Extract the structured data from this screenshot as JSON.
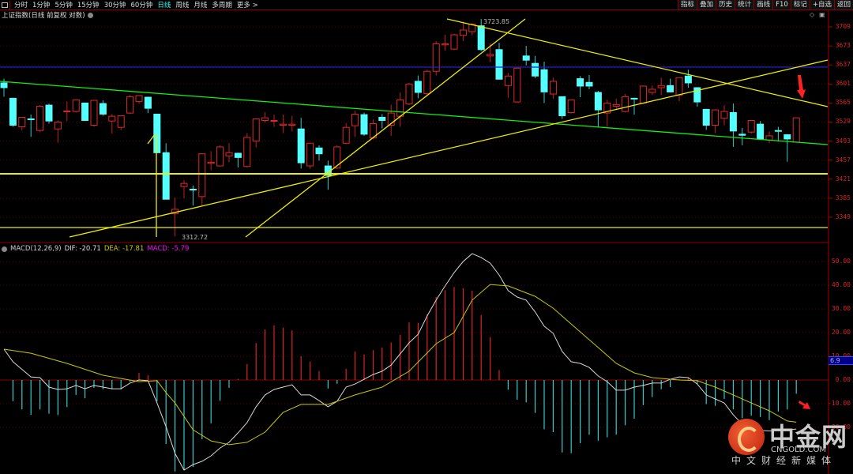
{
  "toolbar": {
    "periods": [
      "分时",
      "1分钟",
      "5分钟",
      "15分钟",
      "30分钟",
      "60分钟",
      "日线",
      "周线",
      "月线",
      "多周期",
      "更多 >"
    ],
    "active_period": "日线",
    "right_buttons": [
      "指标",
      "叠加",
      "历史",
      "统计",
      "画线",
      "F10",
      "标记",
      "+自选",
      "返回"
    ]
  },
  "chart_title": "上证指数(日线 前复权 对数)",
  "macd_header": {
    "name": "MACD(12,26,9)",
    "dif": "DIF: -20.71",
    "dea": "DEA: -17.81",
    "macd": "MACD: -5.79"
  },
  "annotations": {
    "high": "3723.85",
    "low": "3312.72"
  },
  "macd_badge": "6.9",
  "watermark": {
    "cn": "中金网",
    "en": "CNGOLD.COM",
    "sub": "中文财经新媒体"
  },
  "colors": {
    "up": "#ff3232",
    "down": "#54ffff",
    "dif": "#d8d8d8",
    "dea": "#c8c800",
    "macd_label": "#ff00ff",
    "grid": "#5a0000"
  },
  "chart_data": [
    {
      "type": "candlestick",
      "title": "上证指数 日线",
      "price_axis_ticks": [
        "3709",
        "3673",
        "3637",
        "3601",
        "3565",
        "3529",
        "3493",
        "3457",
        "3421",
        "3385",
        "3349"
      ],
      "ylim": [
        3295,
        3760
      ],
      "candles_ohlc": [
        [
          3603,
          3594,
          3611,
          3577
        ],
        [
          3574,
          3523,
          3574,
          3520
        ],
        [
          3520,
          3538,
          3538,
          3513
        ],
        [
          3535,
          3534,
          3543,
          3501
        ],
        [
          3513,
          3559,
          3561,
          3510
        ],
        [
          3561,
          3531,
          3564,
          3526
        ],
        [
          3516,
          3529,
          3532,
          3490
        ],
        [
          3549,
          3550,
          3568,
          3531
        ],
        [
          3549,
          3571,
          3571,
          3547
        ],
        [
          3565,
          3532,
          3565,
          3531
        ],
        [
          3523,
          3570,
          3570,
          3520
        ],
        [
          3564,
          3544,
          3570,
          3541
        ],
        [
          3531,
          3540,
          3544,
          3507
        ],
        [
          3519,
          3541,
          3541,
          3514
        ],
        [
          3546,
          3577,
          3580,
          3544
        ],
        [
          3568,
          3579,
          3580,
          3564
        ],
        [
          3576,
          3555,
          3577,
          3546
        ],
        [
          3544,
          3471,
          3544,
          3470
        ],
        [
          3471,
          3383,
          3489,
          3383
        ],
        [
          3356,
          3364,
          3386,
          3312.72
        ],
        [
          3407,
          3413,
          3419,
          3385
        ],
        [
          3402,
          3401,
          3409,
          3371
        ],
        [
          3388,
          3469,
          3470,
          3371
        ],
        [
          3451,
          3453,
          3474,
          3438
        ],
        [
          3446,
          3482,
          3485,
          3445
        ],
        [
          3465,
          3471,
          3489,
          3453
        ],
        [
          3470,
          3462,
          3471,
          3443
        ],
        [
          3445,
          3500,
          3508,
          3443
        ],
        [
          3493,
          3535,
          3536,
          3481
        ],
        [
          3532,
          3537,
          3548,
          3528
        ],
        [
          3531,
          3532,
          3543,
          3520
        ],
        [
          3523,
          3525,
          3543,
          3508
        ],
        [
          3523,
          3525,
          3541,
          3511
        ],
        [
          3516,
          3452,
          3537,
          3441
        ],
        [
          3446,
          3489,
          3490,
          3441
        ],
        [
          3480,
          3469,
          3485,
          3456
        ],
        [
          3446,
          3428,
          3456,
          3401
        ],
        [
          3442,
          3482,
          3485,
          3440
        ],
        [
          3489,
          3519,
          3527,
          3487
        ],
        [
          3522,
          3544,
          3550,
          3501
        ],
        [
          3543,
          3506,
          3547,
          3503
        ],
        [
          3499,
          3526,
          3534,
          3496
        ],
        [
          3538,
          3532,
          3544,
          3517
        ],
        [
          3523,
          3546,
          3562,
          3503
        ],
        [
          3540,
          3571,
          3585,
          3520
        ],
        [
          3563,
          3601,
          3603,
          3561
        ],
        [
          3606,
          3585,
          3617,
          3574
        ],
        [
          3583,
          3625,
          3628,
          3580
        ],
        [
          3625,
          3677,
          3682,
          3617
        ],
        [
          3675,
          3677,
          3694,
          3664
        ],
        [
          3667,
          3694,
          3696,
          3665
        ],
        [
          3693,
          3703,
          3719,
          3682
        ],
        [
          3700,
          3714,
          3716,
          3693
        ],
        [
          3711,
          3666,
          3723.85,
          3663
        ],
        [
          3654,
          3657,
          3678,
          3642
        ],
        [
          3666,
          3610,
          3679,
          3610
        ],
        [
          3598,
          3616,
          3622,
          3575
        ],
        [
          3567,
          3631,
          3633,
          3566
        ],
        [
          3654,
          3646,
          3673,
          3636
        ],
        [
          3640,
          3616,
          3654,
          3612
        ],
        [
          3628,
          3586,
          3643,
          3565
        ],
        [
          3582,
          3606,
          3613,
          3573
        ],
        [
          3577,
          3541,
          3577,
          3535
        ],
        [
          3547,
          3571,
          3572,
          3545
        ],
        [
          3611,
          3597,
          3616,
          3576
        ],
        [
          3604,
          3597,
          3618,
          3591
        ],
        [
          3585,
          3552,
          3588,
          3520
        ],
        [
          3546,
          3565,
          3571,
          3520
        ],
        [
          3559,
          3562,
          3573,
          3552
        ],
        [
          3549,
          3577,
          3582,
          3547
        ],
        [
          3574,
          3573,
          3575,
          3543
        ],
        [
          3565,
          3597,
          3598,
          3564
        ],
        [
          3585,
          3591,
          3598,
          3580
        ],
        [
          3594,
          3598,
          3613,
          3580
        ],
        [
          3598,
          3586,
          3611,
          3585
        ],
        [
          3580,
          3613,
          3614,
          3568
        ],
        [
          3616,
          3603,
          3628,
          3594
        ],
        [
          3594,
          3567,
          3595,
          3558
        ],
        [
          3553,
          3523,
          3554,
          3514
        ],
        [
          3523,
          3552,
          3553,
          3508
        ],
        [
          3536,
          3549,
          3561,
          3523
        ],
        [
          3547,
          3512,
          3564,
          3482
        ],
        [
          3506,
          3504,
          3518,
          3485
        ],
        [
          3510,
          3532,
          3533,
          3507
        ],
        [
          3525,
          3497,
          3531,
          3495
        ],
        [
          3495,
          3503,
          3511,
          3489
        ],
        [
          3513,
          3512,
          3520,
          3492
        ],
        [
          3505,
          3497,
          3506,
          3454
        ],
        [
          3491,
          3537,
          3538,
          3490
        ]
      ]
    },
    {
      "type": "bar+line",
      "title": "MACD(12,26,9)",
      "axis_ticks": [
        "50.00",
        "40.00",
        "30.00",
        "20.00",
        "10.00",
        "0.00",
        "-10.00",
        "-20.00"
      ],
      "ylim": [
        -40,
        55
      ],
      "macd_hist": [
        0,
        -8.9,
        -12.4,
        -14.7,
        -12.4,
        -14.2,
        -14.8,
        -11.4,
        -6.3,
        -7.7,
        -3.3,
        -3.9,
        -3.9,
        -3.9,
        -0.8,
        3,
        2,
        -9,
        -27,
        -38.6,
        -37.8,
        -36.7,
        -25,
        -18.3,
        -8.7,
        -3.3,
        0.5,
        6.7,
        15.6,
        21.3,
        23,
        22.1,
        20.9,
        10,
        7.8,
        3.8,
        -3.6,
        -1.6,
        4.7,
        12,
        10.8,
        12.6,
        13.7,
        15.8,
        19.1,
        24.3,
        24.1,
        27.7,
        35.1,
        37.9,
        39.2,
        38.7,
        37.7,
        27.4,
        18.1,
        4.2,
        -4.1,
        -8.3,
        -9.4,
        -13.9,
        -20.8,
        -22,
        -30.6,
        -30.9,
        -26.7,
        -23.1,
        -25.6,
        -24.2,
        -23,
        -19.1,
        -16.3,
        -10.6,
        -7.2,
        -3.9,
        -3,
        0.5,
        1,
        -1.7,
        -10.2,
        -10.9,
        -8,
        -12.4,
        -16.1,
        -15,
        -15.6,
        -16.9,
        -13.3,
        -12.4,
        -5.79
      ],
      "dif": [
        13,
        7.7,
        4.5,
        1.3,
        1,
        -3,
        -4,
        -3.7,
        -2.3,
        -3.7,
        -2.3,
        -3,
        -3.7,
        -3.7,
        -1.3,
        0,
        -0.3,
        -9.7,
        -19.7,
        -31,
        -38,
        -35.7,
        -34.3,
        -32,
        -28.7,
        -26.3,
        -22.3,
        -18,
        -11.3,
        -6.3,
        -4,
        -3,
        -2,
        -6.3,
        -6.3,
        -8.7,
        -11.3,
        -9,
        -3,
        -1.7,
        0.3,
        2.3,
        3.7,
        6.3,
        11,
        15.7,
        19.3,
        27,
        33.7,
        39.7,
        45.3,
        50,
        53.3,
        51.7,
        49.3,
        44.3,
        37.7,
        35,
        33.7,
        28.7,
        22.7,
        19.7,
        12,
        7.7,
        7,
        5.3,
        1.7,
        -0.7,
        -4.3,
        -4.3,
        -3,
        -2.3,
        -1.3,
        -1.3,
        0.3,
        1.3,
        1,
        -1.7,
        -6.3,
        -8,
        -9.7,
        -14.7,
        -18.7,
        -19.7,
        -21.3,
        -21.5,
        -21.3,
        -21,
        -20.71
      ],
      "dea_points": [
        [
          0,
          13
        ],
        [
          3,
          11.3
        ],
        [
          7,
          7
        ],
        [
          11,
          2
        ],
        [
          15,
          -0.7
        ],
        [
          17,
          -0.3
        ],
        [
          18,
          -5.3
        ],
        [
          19,
          -9.7
        ],
        [
          21,
          -21
        ],
        [
          23,
          -25.7
        ],
        [
          25,
          -27.3
        ],
        [
          27,
          -26.3
        ],
        [
          29,
          -22
        ],
        [
          31,
          -13.7
        ],
        [
          33,
          -10.3
        ],
        [
          36,
          -10.3
        ],
        [
          39,
          -6.3
        ],
        [
          42,
          -3
        ],
        [
          45,
          3.7
        ],
        [
          48,
          15.3
        ],
        [
          50,
          20
        ],
        [
          52,
          33.7
        ],
        [
          54,
          40.3
        ],
        [
          56,
          39.7
        ],
        [
          59,
          35.3
        ],
        [
          61,
          30.3
        ],
        [
          64,
          20.3
        ],
        [
          66,
          13.7
        ],
        [
          68,
          7
        ],
        [
          70,
          3
        ],
        [
          72,
          1
        ],
        [
          75,
          0
        ],
        [
          77,
          -0.3
        ],
        [
          79,
          -3
        ],
        [
          81,
          -6.3
        ],
        [
          83,
          -9.7
        ],
        [
          85,
          -13
        ],
        [
          87,
          -17.3
        ],
        [
          88,
          -17.81
        ]
      ]
    }
  ]
}
